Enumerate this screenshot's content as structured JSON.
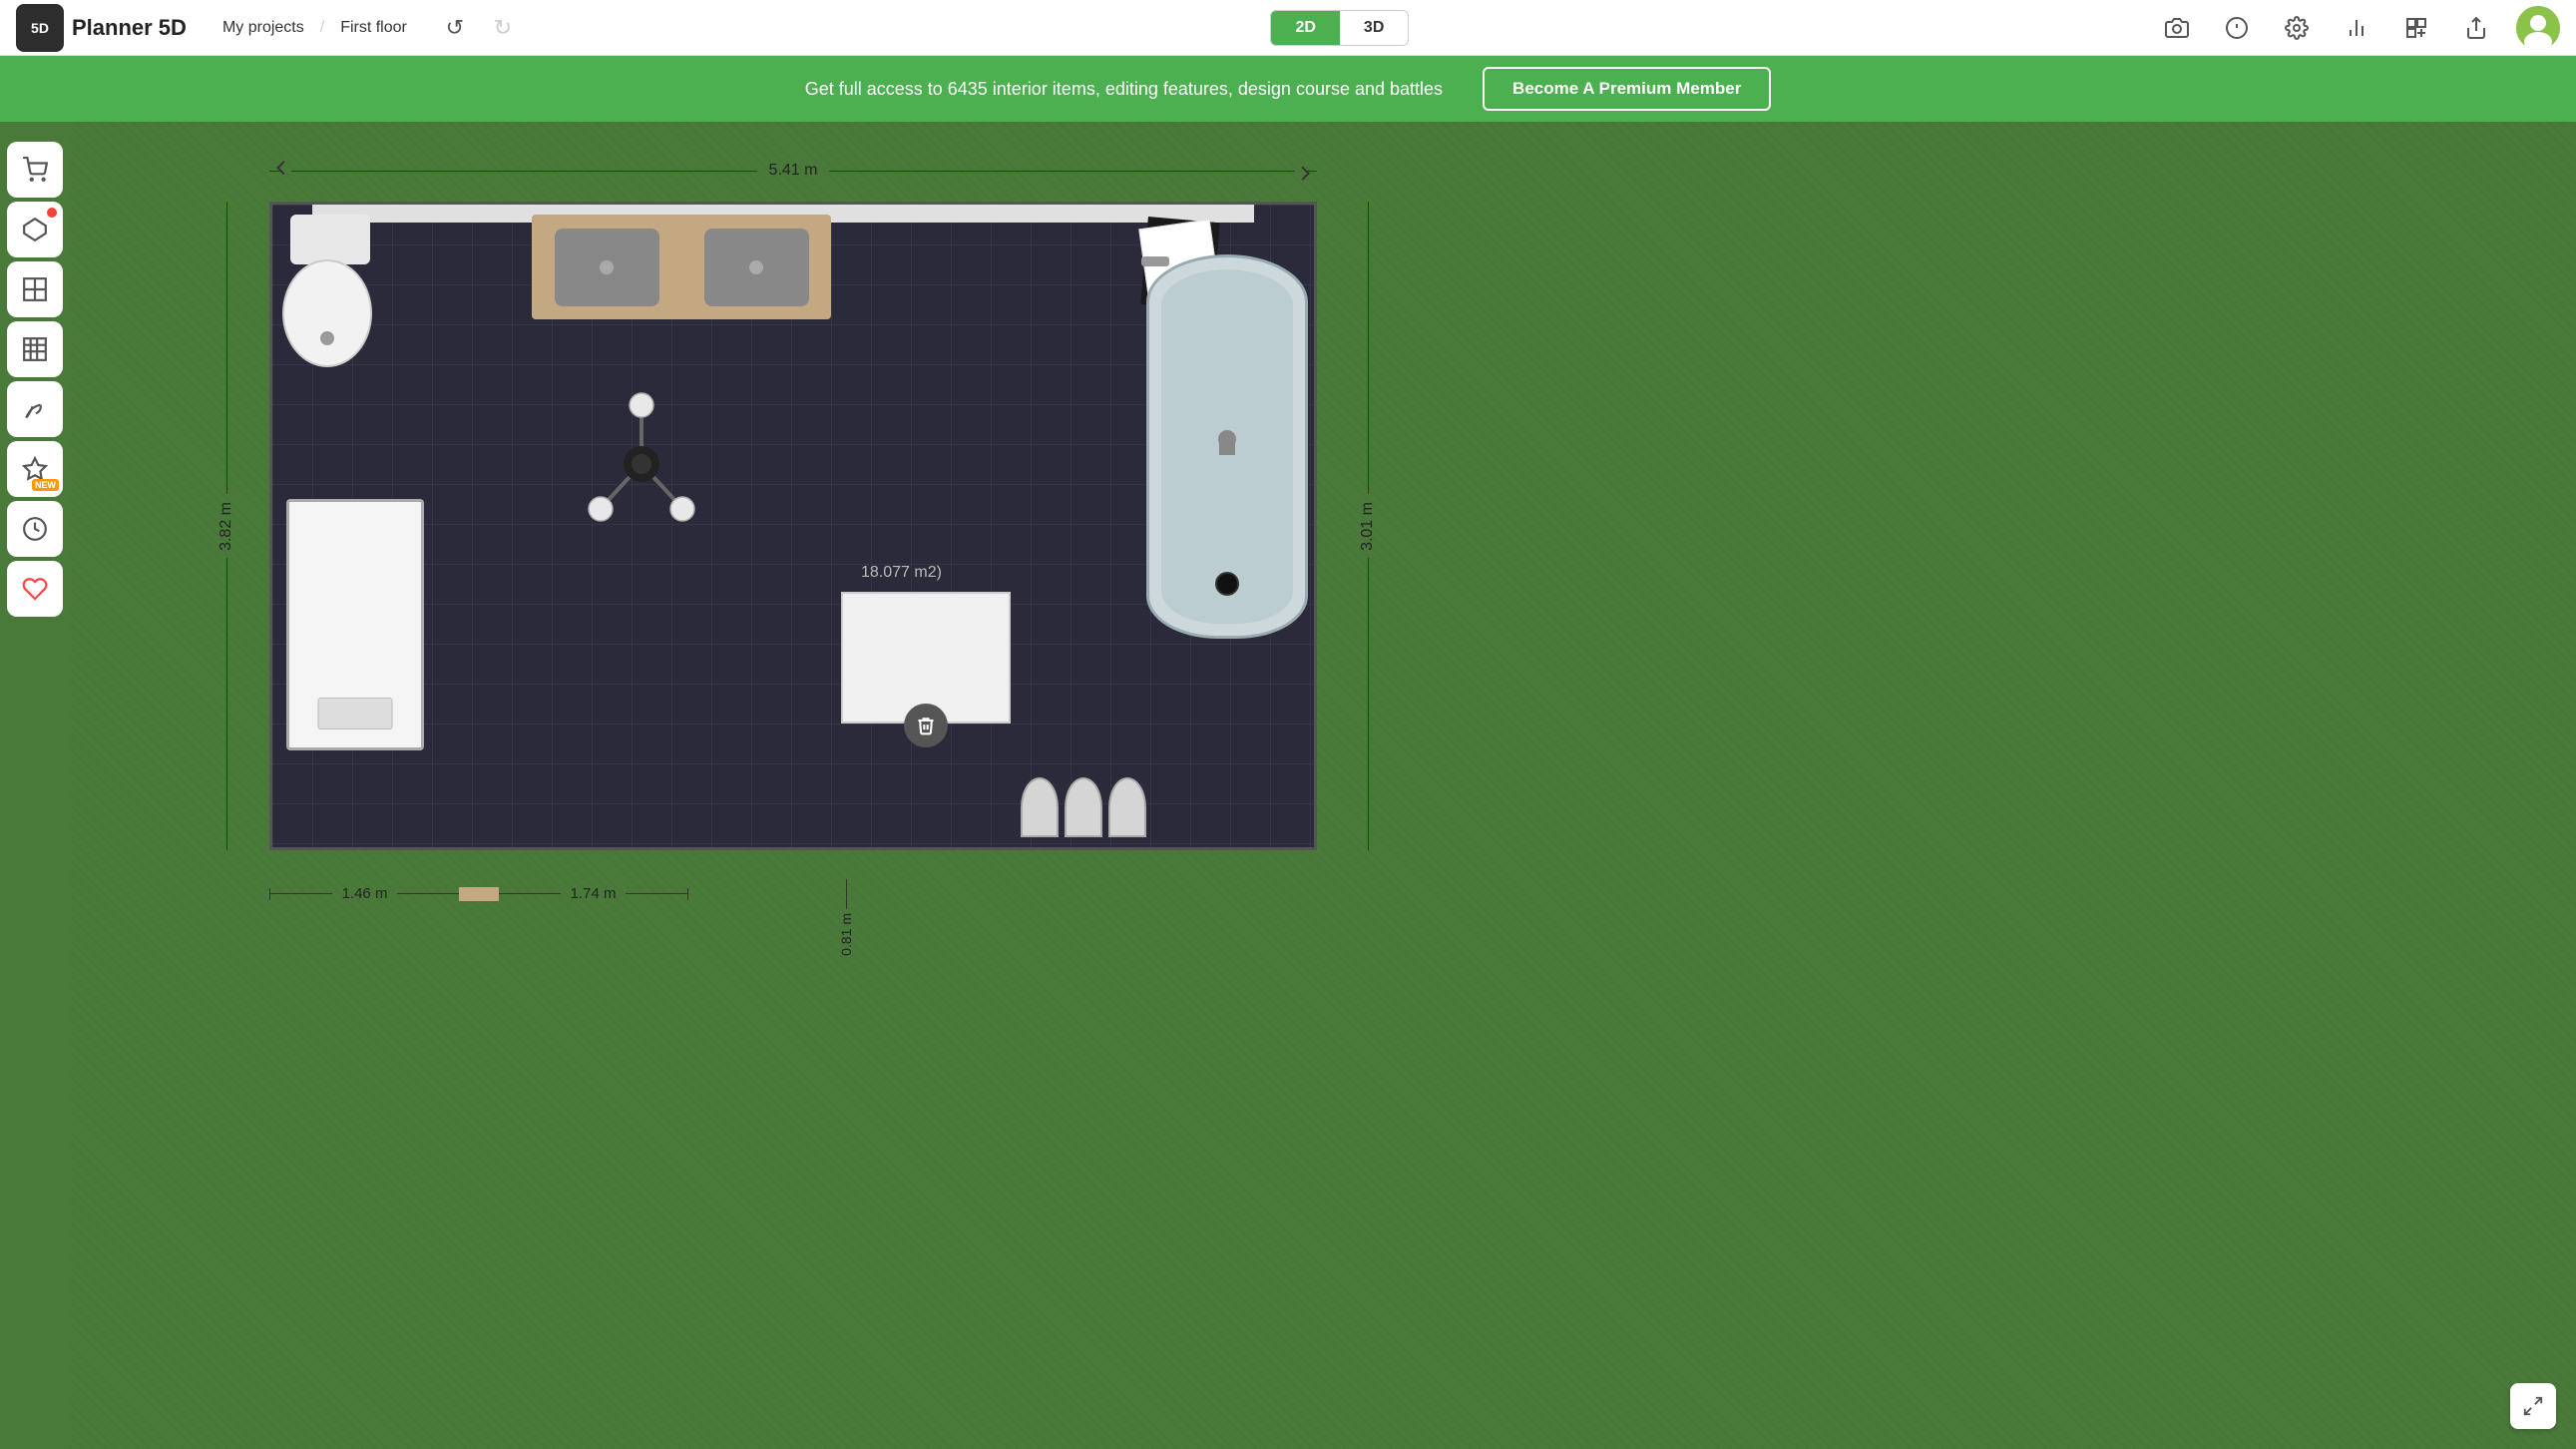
{
  "header": {
    "logo_text": "Planner 5D",
    "nav": {
      "my_projects": "My projects",
      "separator": "/",
      "current_floor": "First floor"
    },
    "view_toggle": {
      "2d_label": "2D",
      "3d_label": "3D",
      "active": "2D"
    },
    "tools": {
      "camera_icon": "📷",
      "info_icon": "ℹ",
      "settings_icon": "⚙",
      "stats_icon": "📊",
      "add_floor_icon": "⊞",
      "share_icon": "↑"
    }
  },
  "banner": {
    "text": "Get full access to 6435 interior items, editing features, design course and battles",
    "cta_label": "Become A Premium Member",
    "background_color": "#4caf50"
  },
  "sidebar": {
    "items": [
      {
        "name": "shop",
        "icon": "🛒",
        "badge": false
      },
      {
        "name": "objects",
        "icon": "⬡",
        "badge": true
      },
      {
        "name": "rooms",
        "icon": "▣",
        "badge": false
      },
      {
        "name": "walls",
        "icon": "▦",
        "badge": false
      },
      {
        "name": "landscaping",
        "icon": "🌳",
        "badge": false
      },
      {
        "name": "new-feature",
        "icon": "✦",
        "badge": false,
        "new": true
      },
      {
        "name": "history",
        "icon": "⏱",
        "badge": false
      },
      {
        "name": "favorites",
        "icon": "♥",
        "badge": false
      }
    ]
  },
  "floor_plan": {
    "title": "First floor",
    "dimensions": {
      "width": "5.41 m",
      "height": "3.01 m",
      "left_height": "3.82 m",
      "bottom_left": "1.46 m",
      "bottom_right": "1.74 m",
      "bottom_vertical": "0.81 m"
    },
    "area_label": "18.077 m2)",
    "room_color": "#2a2a3a"
  },
  "ui": {
    "delete_icon": "🗑",
    "expand_icon": "⤡",
    "undo_icon": "↺",
    "redo_icon": "↻"
  }
}
